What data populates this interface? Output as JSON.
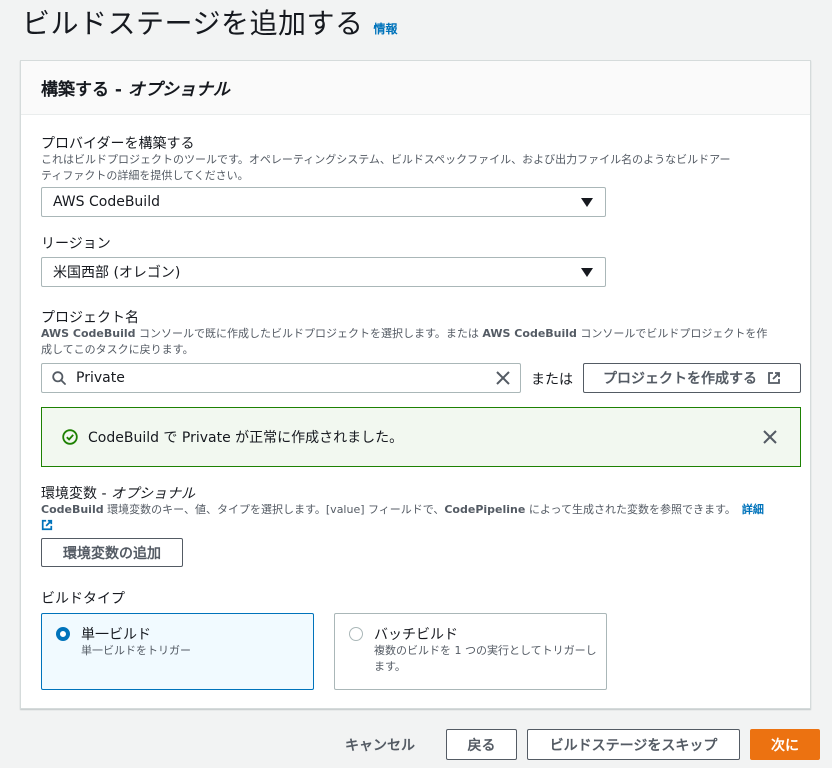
{
  "page": {
    "title": "ビルドステージを追加する",
    "info_link": "情報"
  },
  "panel": {
    "title_main": "構築する - ",
    "title_optional": "オプショナル"
  },
  "provider": {
    "label": "プロバイダーを構築する",
    "description_line1": "これはビルドプロジェクトのツールです。オペレーティングシステム、ビルドスペックファイル、および出力ファイル名のようなビルドアー",
    "description_line2": "ティファクトの詳細を提供してください。",
    "selected": "AWS CodeBuild"
  },
  "region": {
    "label": "リージョン",
    "selected": "米国西部 (オレゴン)"
  },
  "project": {
    "label": "プロジェクト名",
    "description_line1_part1": "AWS CodeBuild",
    "description_line1_part2": " コンソールで既に作成したビルドプロジェクトを選択します。または ",
    "description_line1_part3": "AWS CodeBuild",
    "description_line1_part4": " コンソールでビルドプロジェクトを作",
    "description_line2": "成してこのタスクに戻ります。",
    "search_value": "Private",
    "or_text": "または",
    "create_button": "プロジェクトを作成する"
  },
  "alert": {
    "part1": "CodeBuild",
    "part2": " で ",
    "part3": "Private",
    "part4": " が正常に作成されました。",
    "status_color": "#1d8102"
  },
  "env_vars": {
    "label_main": "環境変数 - ",
    "label_optional": "オプショナル",
    "desc_part1": "CodeBuild",
    "desc_part2": " 環境変数のキー、値、タイプを選択します。[value] フィールドで、",
    "desc_part3": "CodePipeline",
    "desc_part4": " によって生成された変数を参照できます。",
    "details_link": "詳細",
    "add_button": "環境変数の追加"
  },
  "build_type": {
    "label": "ビルドタイプ",
    "options": [
      {
        "title": "単一ビルド",
        "desc": "単一ビルドをトリガー",
        "selected": true
      },
      {
        "title": "バッチビルド",
        "desc": "複数のビルドを 1 つの実行としてトリガーします。",
        "selected": false
      }
    ]
  },
  "footer": {
    "cancel": "キャンセル",
    "back": "戻る",
    "skip": "ビルドステージをスキップ",
    "next": "次に"
  },
  "colors": {
    "accent": "#0073bb",
    "primary_button": "#ec7211",
    "success": "#1d8102"
  }
}
